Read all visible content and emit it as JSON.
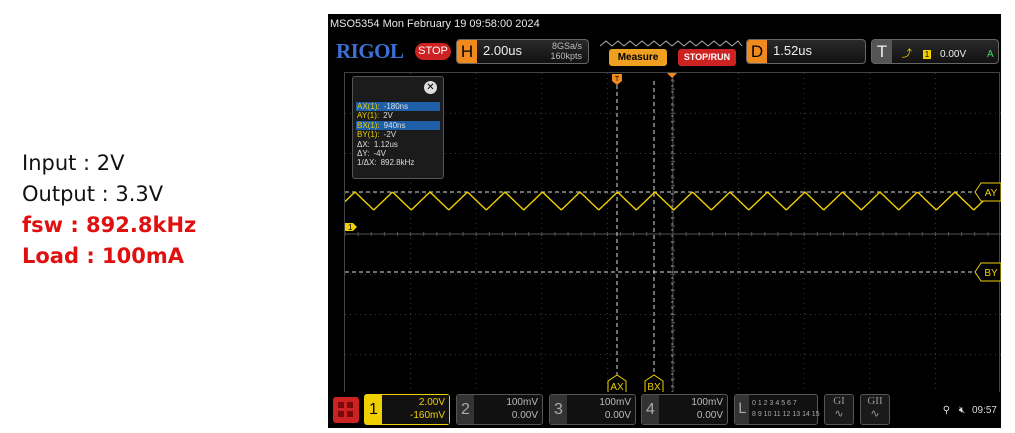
{
  "annotation": {
    "input": "Input : 2V",
    "output": "Output : 3.3V",
    "fsw": "fsw : 892.8kHz",
    "load": "Load : 100mA"
  },
  "scope": {
    "title": "MSO5354  Mon February 19 09:58:00 2024",
    "logo": "RIGOL",
    "status": "STOP",
    "horizontal": {
      "key": "H",
      "timebase": "2.00us",
      "sample_rate": "8GSa/s",
      "memory": "160kpts"
    },
    "measure_label": "Measure",
    "stoprun_label": "STOP/RUN",
    "delay": {
      "key": "D",
      "value": "1.52us"
    },
    "trigger": {
      "key": "T",
      "channel": "1",
      "level": "0.00V",
      "mode": "A"
    },
    "cursor_panel": {
      "rows": [
        {
          "k": "AX(1):",
          "v": "-180ns",
          "highlight": true
        },
        {
          "k": "AY(1):",
          "v": "2V",
          "highlight": false
        },
        {
          "k": "BX(1):",
          "v": "940ns",
          "highlight": true
        },
        {
          "k": "BY(1):",
          "v": "-2V",
          "highlight": false
        },
        {
          "k": "ΔX:",
          "v": "1.12us",
          "highlight": false,
          "plain": true
        },
        {
          "k": "ΔY:",
          "v": "-4V",
          "highlight": false,
          "plain": true
        },
        {
          "k": "1/ΔX:",
          "v": "892.8kHz",
          "highlight": false,
          "plain": true
        }
      ]
    },
    "cursor_labels": {
      "ax": "AX",
      "bx": "BX",
      "ay": "AY",
      "by": "BY"
    },
    "channel_marker": "1",
    "trigger_marker": "T",
    "channels": [
      {
        "num": "1",
        "scale": "2.00V",
        "offset": "-160mV",
        "active": true
      },
      {
        "num": "2",
        "scale": "100mV",
        "offset": "0.00V",
        "active": false
      },
      {
        "num": "3",
        "scale": "100mV",
        "offset": "0.00V",
        "active": false
      },
      {
        "num": "4",
        "scale": "100mV",
        "offset": "0.00V",
        "active": false
      }
    ],
    "la": {
      "key": "L",
      "bits_row1": "0 1 2 3  4 5 6 7",
      "bits_row2": "8 9 10 11 12 13 14 15"
    },
    "gen_buttons": [
      "GI",
      "GII"
    ],
    "clock": "09:57",
    "colors": {
      "ch1": "#f0d000",
      "accent": "#f08a1e",
      "stop": "#cc2222"
    }
  }
}
